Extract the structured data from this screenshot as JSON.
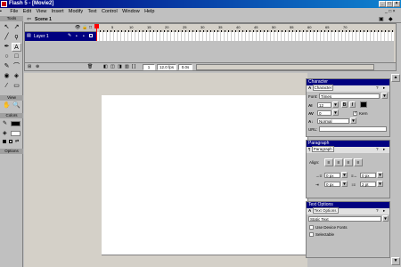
{
  "window": {
    "title": "Flash 5 - [Movie2]"
  },
  "menu": [
    "File",
    "Edit",
    "View",
    "Insert",
    "Modify",
    "Text",
    "Control",
    "Window",
    "Help"
  ],
  "scene": {
    "label": "Scene 1"
  },
  "tools": {
    "title": "Tools",
    "view_title": "View",
    "colors_title": "Colors",
    "options_title": "Options"
  },
  "timeline": {
    "layer": "Layer 1",
    "frame": "1",
    "fps": "12.0 fps",
    "time": "0.0s",
    "ruler": [
      "1",
      "5",
      "10",
      "15",
      "20",
      "25",
      "30",
      "35",
      "40",
      "45",
      "50",
      "55",
      "60",
      "65",
      "70"
    ]
  },
  "character": {
    "title": "Character",
    "tab": "Character",
    "font_label": "Font:",
    "font_value": "Times",
    "size_value": "12",
    "tracking_value": "0",
    "baseline_value": "Normal",
    "kern_label": "Kern",
    "url_label": "URL:",
    "bold": "B",
    "italic": "I"
  },
  "paragraph": {
    "title": "Paragraph",
    "tab": "Paragraph",
    "align_label": "Align:",
    "left_margin": "0 px",
    "right_margin": "0 px",
    "indent": "0 px",
    "line_space": "2 pt"
  },
  "textopts": {
    "title": "Text Options",
    "tab": "Text Options",
    "type_value": "Static Text",
    "device_fonts": "Use Device Fonts",
    "selectable": "Selectable"
  }
}
